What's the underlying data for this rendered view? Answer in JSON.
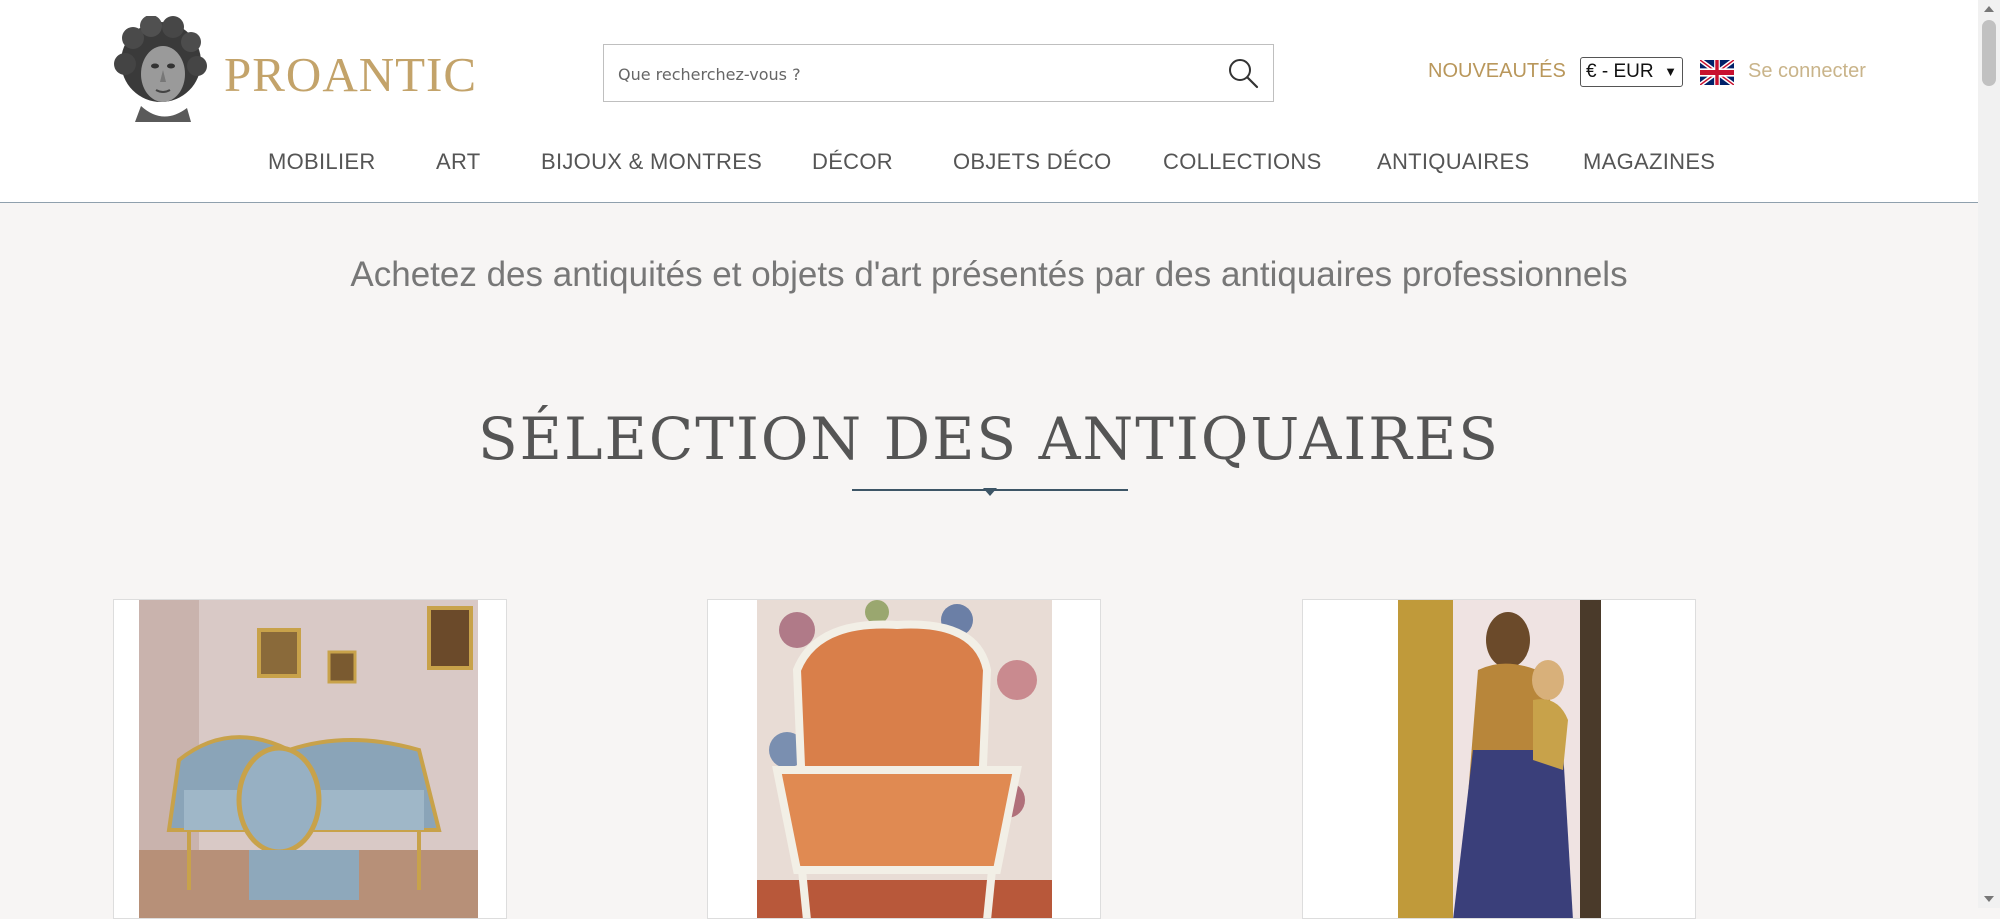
{
  "header": {
    "logo_text": "PROANTIC",
    "search_placeholder": "Que recherchez-vous ?",
    "nouveautes": "NOUVEAUTÉS",
    "currency": "€ - EUR",
    "login": "Se connecter",
    "colors": {
      "gold": "#c3a36a",
      "nav_border": "#8fa0ad"
    }
  },
  "nav": [
    {
      "label": "MOBILIER"
    },
    {
      "label": "ART"
    },
    {
      "label": "BIJOUX & MONTRES"
    },
    {
      "label": "DÉCOR"
    },
    {
      "label": "OBJETS DÉCO"
    },
    {
      "label": "COLLECTIONS"
    },
    {
      "label": "ANTIQUAIRES"
    },
    {
      "label": "MAGAZINES"
    }
  ],
  "tagline": "Achetez des antiquités et objets d'art présentés par des antiquaires professionnels",
  "section_title": "SÉLECTION DES ANTIQUAIRES",
  "products": [
    {
      "image": "blue-gilt-salon-suite-photo"
    },
    {
      "image": "upholstered-armchair-photo"
    },
    {
      "image": "madonna-statue-photo"
    }
  ]
}
